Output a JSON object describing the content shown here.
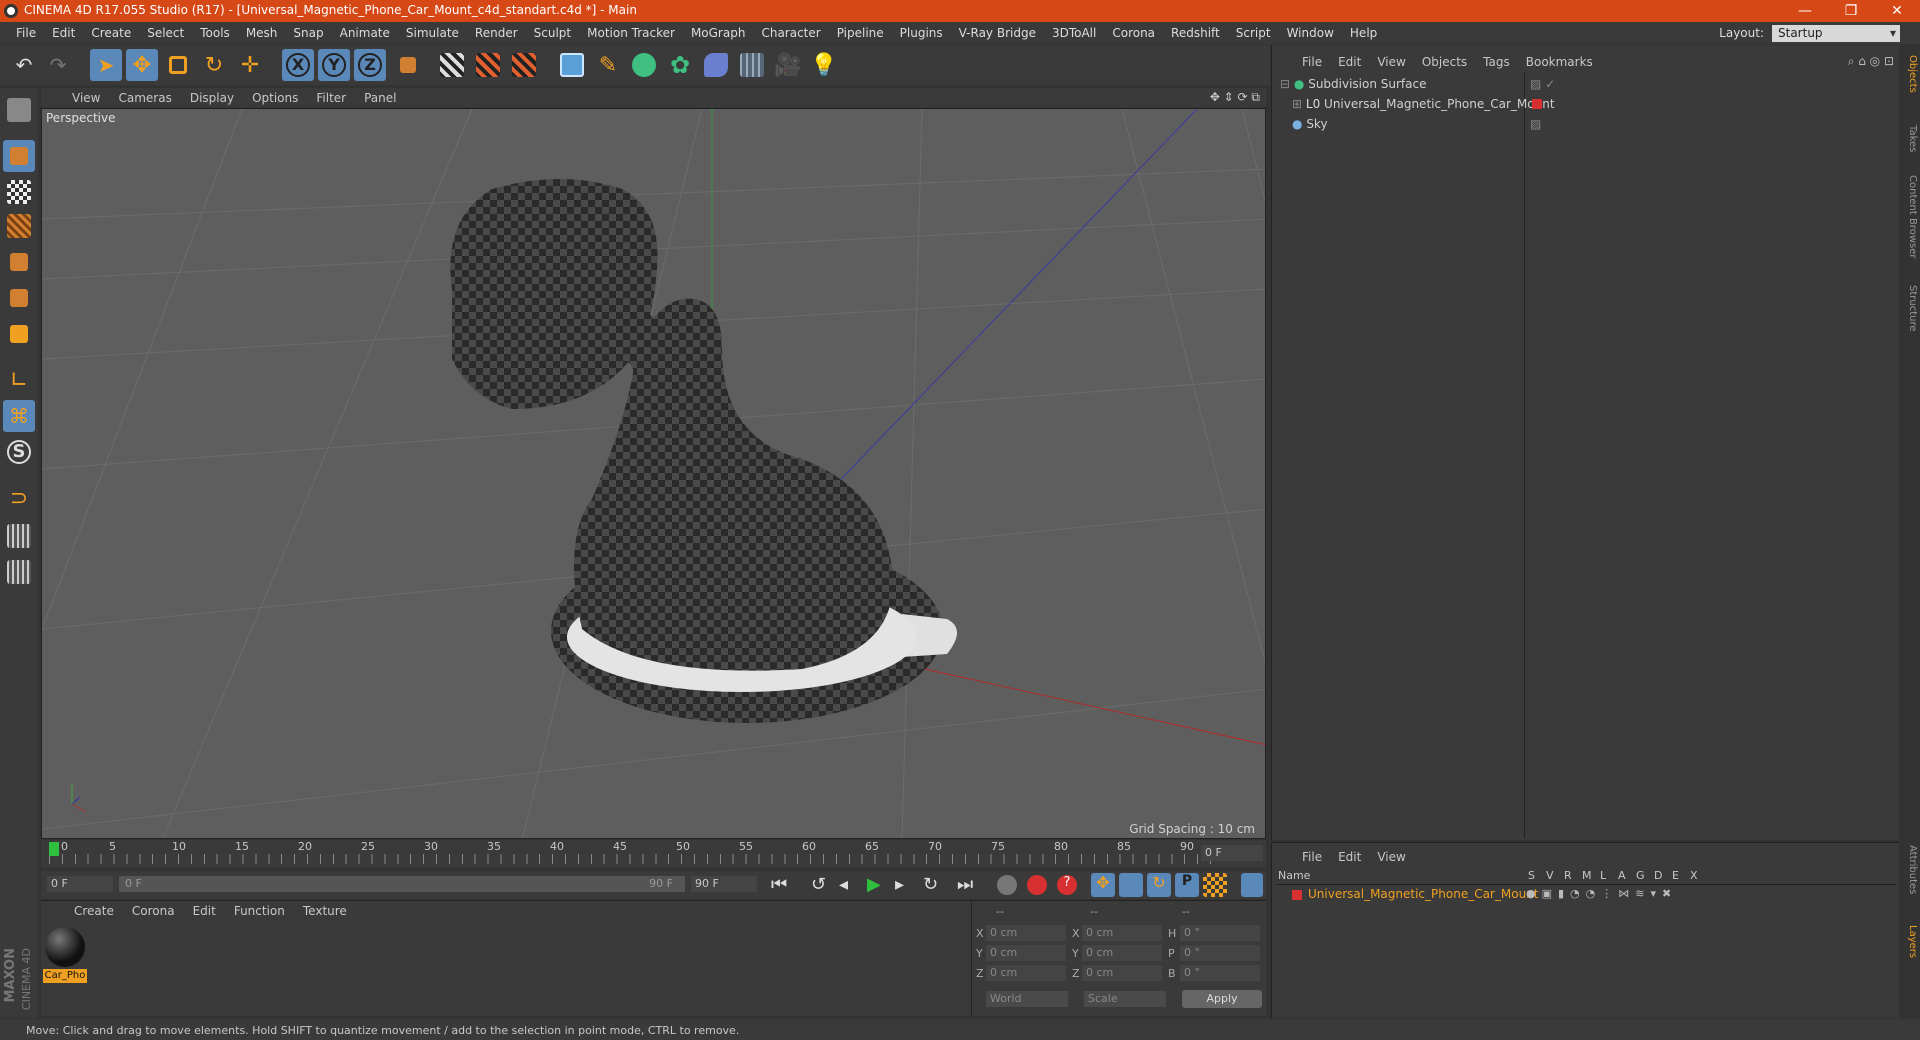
{
  "titlebar": {
    "title": "CINEMA 4D R17.055 Studio (R17) - [Universal_Magnetic_Phone_Car_Mount_c4d_standart.c4d *] - Main",
    "minimize": "—",
    "restore": "❐",
    "close": "✕"
  },
  "menubar": {
    "items": [
      "File",
      "Edit",
      "Create",
      "Select",
      "Tools",
      "Mesh",
      "Snap",
      "Animate",
      "Simulate",
      "Render",
      "Sculpt",
      "Motion Tracker",
      "MoGraph",
      "Character",
      "Pipeline",
      "Plugins",
      "V-Ray Bridge",
      "3DToAll",
      "Corona",
      "Redshift",
      "Script",
      "Window",
      "Help"
    ],
    "layout_label": "Layout:",
    "layout_value": "Startup"
  },
  "viewport": {
    "menu": [
      "View",
      "Cameras",
      "Display",
      "Options",
      "Filter",
      "Panel"
    ],
    "label": "Perspective",
    "grid_spacing": "Grid Spacing : 10 cm"
  },
  "timeline": {
    "ticks": [
      "0",
      "5",
      "10",
      "15",
      "20",
      "25",
      "30",
      "35",
      "40",
      "45",
      "50",
      "55",
      "60",
      "65",
      "70",
      "75",
      "80",
      "85",
      "90"
    ],
    "frame_field": "0 F",
    "start_field": "0 F",
    "range_start": "0 F",
    "range_end": "90 F",
    "end_field": "90 F"
  },
  "material_manager": {
    "menu": [
      "Create",
      "Corona",
      "Edit",
      "Function",
      "Texture"
    ],
    "material_name": "Car_Pho"
  },
  "coordinates": {
    "header": [
      "--",
      "--",
      "--"
    ],
    "rows": [
      {
        "a": "X",
        "av": "0 cm",
        "b": "X",
        "bv": "0 cm",
        "c": "H",
        "cv": "0 °"
      },
      {
        "a": "Y",
        "av": "0 cm",
        "b": "Y",
        "bv": "0 cm",
        "c": "P",
        "cv": "0 °"
      },
      {
        "a": "Z",
        "av": "0 cm",
        "b": "Z",
        "bv": "0 cm",
        "c": "B",
        "cv": "0 °"
      }
    ],
    "mode1": "World",
    "mode2": "Scale",
    "apply": "Apply"
  },
  "object_manager": {
    "menu": [
      "File",
      "Edit",
      "View",
      "Objects",
      "Tags",
      "Bookmarks"
    ],
    "objects": [
      "Subdivision Surface",
      "Universal_Magnetic_Phone_Car_Mount",
      "Sky"
    ]
  },
  "attribute_manager": {
    "menu": [
      "File",
      "Edit",
      "View"
    ],
    "columns": [
      "Name",
      "S",
      "V",
      "R",
      "M",
      "L",
      "A",
      "G",
      "D",
      "E",
      "X"
    ],
    "layer_name": "Universal_Magnetic_Phone_Car_Mount"
  },
  "right_tabs": [
    "Objects",
    "Takes",
    "Content Browser",
    "Structure",
    "Attributes",
    "Layers"
  ],
  "brand": [
    "MAXON",
    "CINEMA 4D"
  ],
  "statusbar": "Move: Click and drag to move elements. Hold SHIFT to quantize movement / add to the selection in point mode, CTRL to remove.",
  "colors": {
    "title": "#d74817",
    "accent": "#5a88b8",
    "selected_text": "#f0a020"
  }
}
